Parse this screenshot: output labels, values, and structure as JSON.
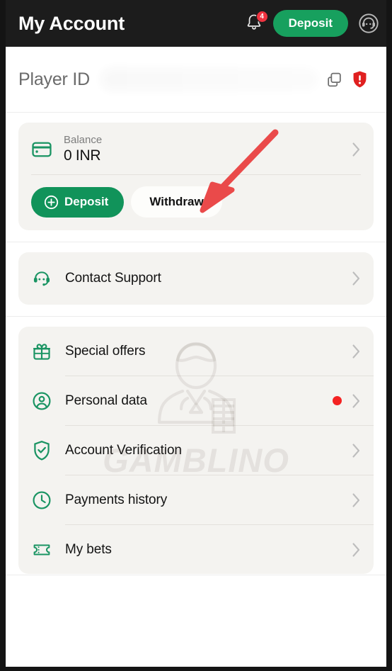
{
  "header": {
    "title": "My Account",
    "notification_icon": "bell-icon",
    "notification_count": "4",
    "deposit_label": "Deposit",
    "support_icon": "headset-icon"
  },
  "player_id": {
    "label": "Player ID",
    "value_hidden": true,
    "copy_icon": "copy-icon",
    "shield_alert_icon": "shield-alert-icon"
  },
  "balance_card": {
    "icon": "credit-card-icon",
    "label": "Balance",
    "amount": "0 INR",
    "chevron_icon": "chevron-right-icon",
    "deposit_label": "Deposit",
    "deposit_icon": "plus-circle-icon",
    "withdraw_label": "Withdraw"
  },
  "support_card": {
    "icon": "headset-icon",
    "label": "Contact Support",
    "chevron_icon": "chevron-right-icon"
  },
  "menu": {
    "items": [
      {
        "label": "Special offers",
        "icon": "gift-icon",
        "badge_dot": false
      },
      {
        "label": "Personal data",
        "icon": "user-circle-icon",
        "badge_dot": true
      },
      {
        "label": "Account Verification",
        "icon": "shield-check-icon",
        "badge_dot": false
      },
      {
        "label": "Payments history",
        "icon": "clock-icon",
        "badge_dot": false
      },
      {
        "label": "My bets",
        "icon": "ticket-icon",
        "badge_dot": false
      }
    ]
  },
  "watermark": {
    "text": "GAMBLINO",
    "figure_icon": "croupier-icon"
  },
  "annotation": {
    "type": "arrow",
    "points_to": "Withdraw",
    "color": "#ea4a4a"
  },
  "colors": {
    "brand_green": "#11935a",
    "header_bg": "#1c1c1c",
    "card_bg": "#f4f3f0",
    "badge_red": "#ef3340",
    "alert_red": "#e02020",
    "dot_red": "#f42222"
  }
}
